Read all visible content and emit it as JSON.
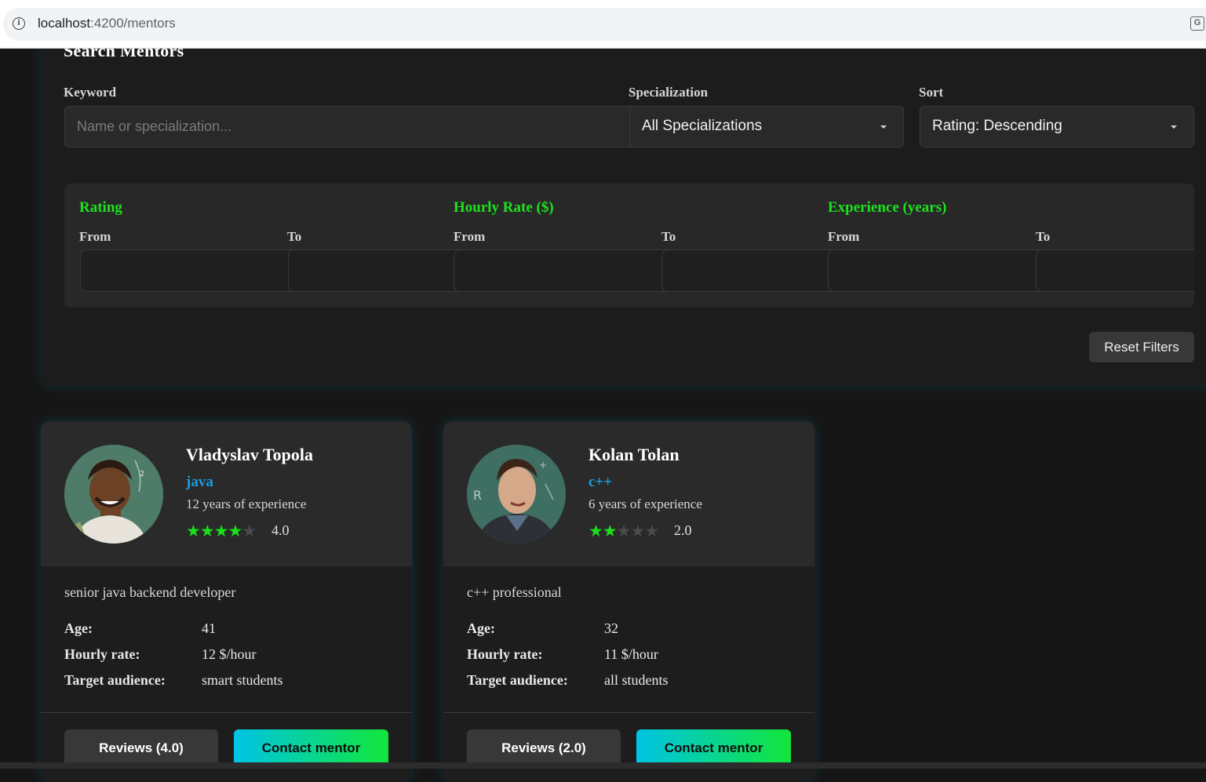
{
  "browser": {
    "url_host": "localhost",
    "url_path": ":4200/mentors",
    "info_icon": "info-icon",
    "translate_icon": "translate-icon"
  },
  "search": {
    "title": "Search Mentors",
    "keyword_label": "Keyword",
    "keyword_placeholder": "Name or specialization...",
    "keyword_value": "",
    "specialization_label": "Specialization",
    "specialization_value": "All Specializations",
    "sort_label": "Sort",
    "sort_value": "Rating: Descending"
  },
  "ranges": [
    {
      "title": "Rating",
      "from_label": "From",
      "to_label": "To",
      "from_value": "",
      "to_value": ""
    },
    {
      "title": "Hourly Rate ($)",
      "from_label": "From",
      "to_label": "To",
      "from_value": "",
      "to_value": ""
    },
    {
      "title": "Experience (years)",
      "from_label": "From",
      "to_label": "To",
      "from_value": "",
      "to_value": ""
    }
  ],
  "reset_label": "Reset Filters",
  "colors": {
    "accent_green": "#1de21d",
    "specialization_blue": "#1a9fe6",
    "background": "#161616",
    "card_header": "#2a2a2a"
  },
  "mentors": [
    {
      "name": "Vladyslav Topola",
      "specialization": "java",
      "experience": "12 years of experience",
      "stars": 4,
      "max_stars": 5,
      "rating": "4.0",
      "description": "senior java backend developer",
      "age_label": "Age:",
      "age": "41",
      "rate_label": "Hourly rate:",
      "rate": "12 $/hour",
      "audience_label": "Target audience:",
      "audience": "smart students",
      "reviews_label": "Reviews (4.0)",
      "contact_label": "Contact mentor"
    },
    {
      "name": "Kolan Tolan",
      "specialization": "c++",
      "experience": "6 years of experience",
      "stars": 2,
      "max_stars": 5,
      "rating": "2.0",
      "description": "c++ professional",
      "age_label": "Age:",
      "age": "32",
      "rate_label": "Hourly rate:",
      "rate": "11 $/hour",
      "audience_label": "Target audience:",
      "audience": "all students",
      "reviews_label": "Reviews (2.0)",
      "contact_label": "Contact mentor"
    }
  ]
}
